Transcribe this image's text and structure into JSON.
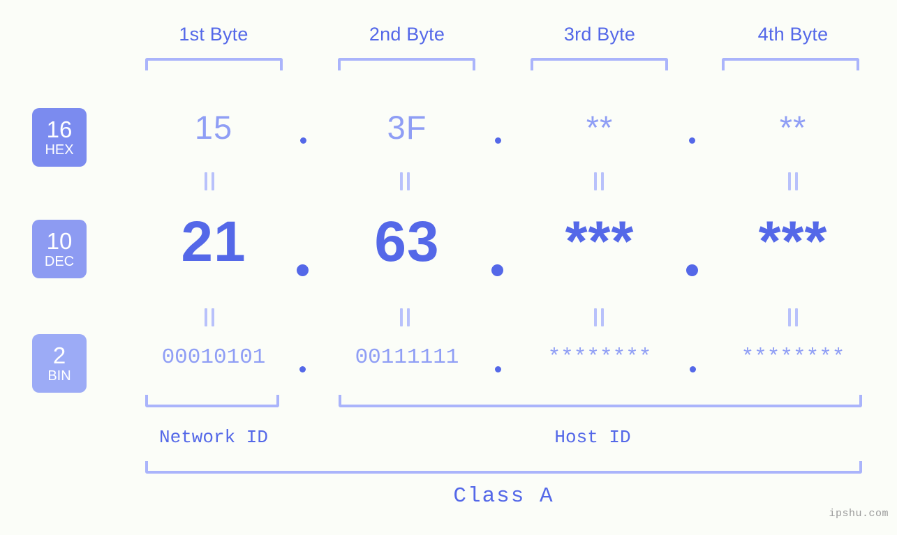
{
  "background_color": "#fbfdf8",
  "accent_color": "#5468e8",
  "accent_light_color": "#8f9ef5",
  "bracket_color": "#aab4fb",
  "byte_headers": [
    {
      "label": "1st Byte"
    },
    {
      "label": "2nd Byte"
    },
    {
      "label": "3rd Byte"
    },
    {
      "label": "4th Byte"
    }
  ],
  "rows": [
    {
      "badge": {
        "number": "16",
        "name": "HEX",
        "color": "#7b8bef"
      },
      "values": [
        "15",
        "3F",
        "**",
        "**"
      ],
      "separator": "."
    },
    {
      "badge": {
        "number": "10",
        "name": "DEC",
        "color": "#8d9bf2"
      },
      "values": [
        "21",
        "63",
        "***",
        "***"
      ],
      "separator": "."
    },
    {
      "badge": {
        "number": "2",
        "name": "BIN",
        "color": "#9cabf6"
      },
      "values": [
        "00010101",
        "00111111",
        "********",
        "********"
      ],
      "separator": "."
    }
  ],
  "equals_connector": "=",
  "id_sections": [
    {
      "label": "Network ID"
    },
    {
      "label": "Host ID"
    }
  ],
  "class_label": "Class A",
  "watermark": "ipshu.com"
}
